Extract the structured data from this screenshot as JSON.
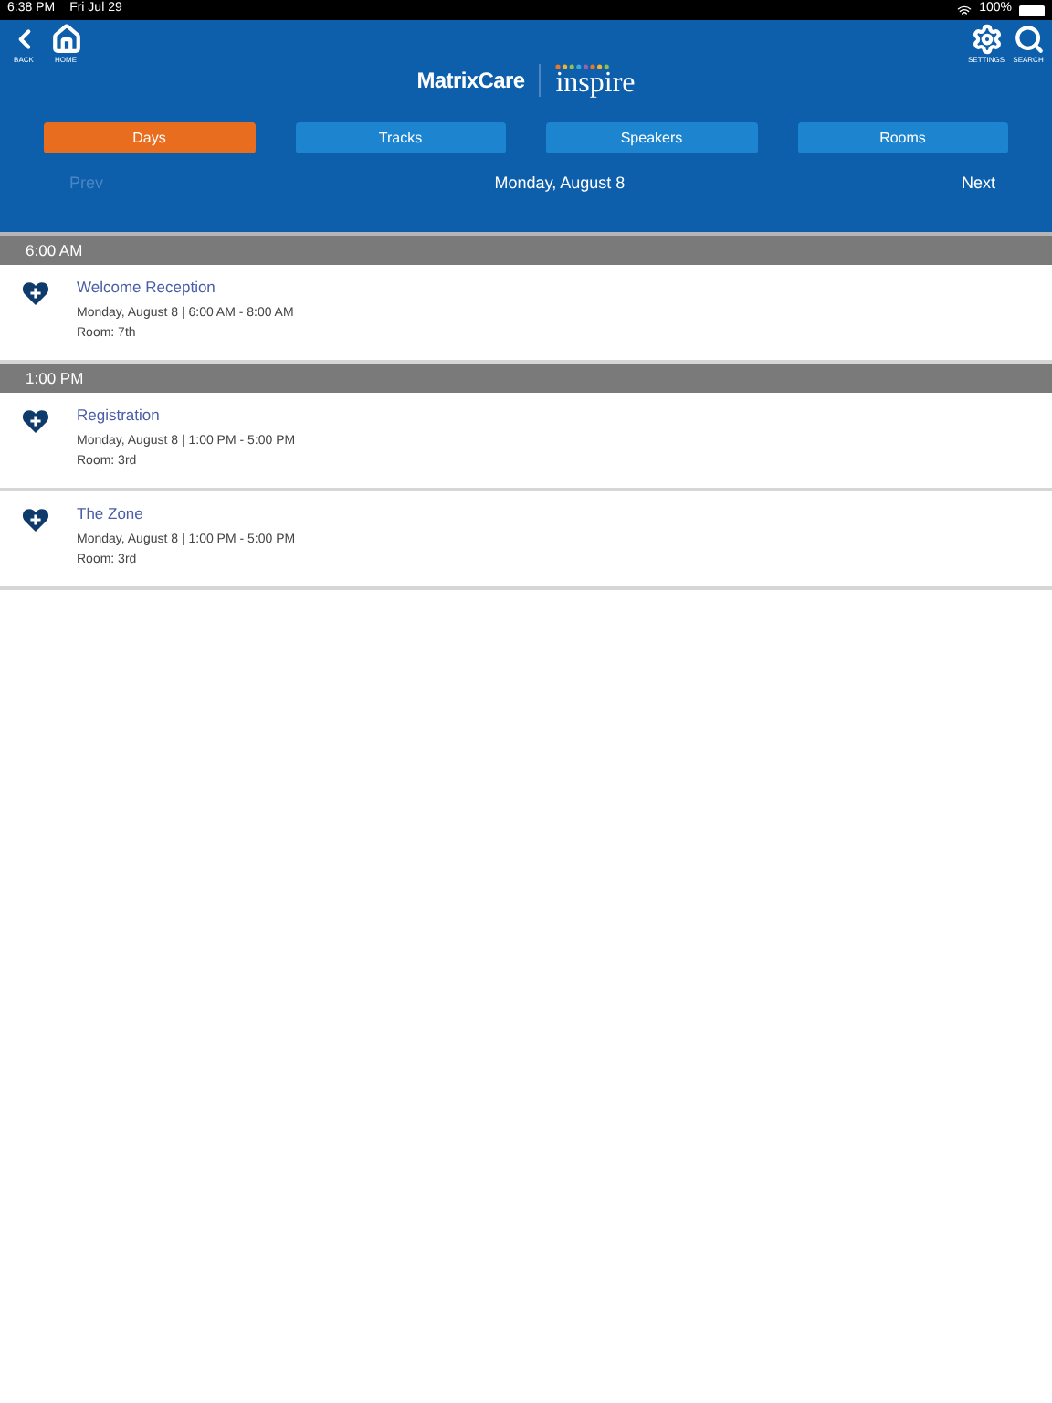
{
  "status_bar": {
    "time": "6:38 PM",
    "date": "Fri Jul 29",
    "battery": "100%"
  },
  "toolbar": {
    "left": [
      {
        "kind": "back",
        "label": "BACK"
      },
      {
        "kind": "home",
        "label": "HOME"
      }
    ],
    "right": [
      {
        "kind": "settings",
        "label": "SETTINGS"
      },
      {
        "kind": "search",
        "label": "SEARCH"
      }
    ]
  },
  "logo": {
    "brand": "MatrixCare",
    "event": "inspire"
  },
  "tabs": [
    {
      "label": "Days",
      "selected": true
    },
    {
      "label": "Tracks",
      "selected": false
    },
    {
      "label": "Speakers",
      "selected": false
    },
    {
      "label": "Rooms",
      "selected": false
    }
  ],
  "day_nav": {
    "prev": {
      "label": "Prev",
      "disabled": true
    },
    "current": "Monday, August 8",
    "next": {
      "label": "Next",
      "disabled": false
    }
  },
  "sections": [
    {
      "time": "6:00 AM",
      "sessions": [
        {
          "title": "Welcome Reception",
          "when": "Monday, August 8 | 6:00 AM - 8:00 AM",
          "room": "Room: 7th"
        }
      ]
    },
    {
      "time": "1:00 PM",
      "sessions": [
        {
          "title": "Registration",
          "when": "Monday, August 8 | 1:00 PM - 5:00 PM",
          "room": "Room: 3rd"
        },
        {
          "title": "The Zone",
          "when": "Monday, August 8 | 1:00 PM - 5:00 PM",
          "room": "Room: 3rd"
        }
      ]
    }
  ]
}
